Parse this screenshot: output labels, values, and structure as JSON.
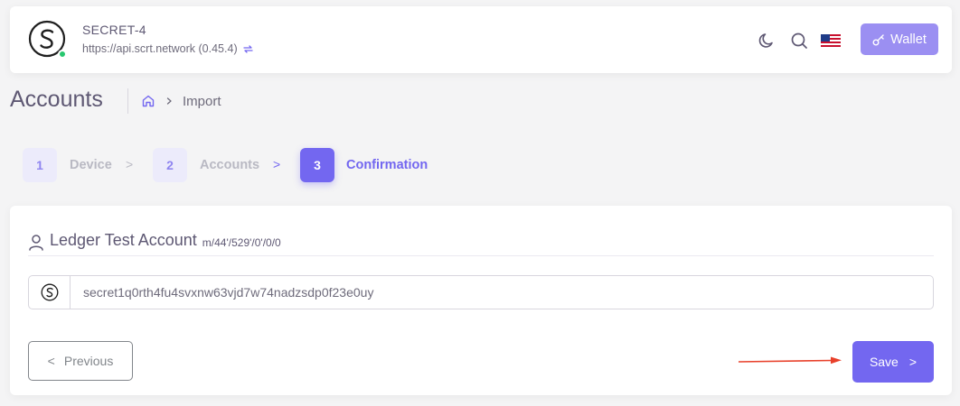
{
  "navbar": {
    "chain_name": "SECRET-4",
    "endpoint": "https://api.scrt.network (0.45.4)",
    "wallet_label": "Wallet",
    "icons": [
      "secret-logo-icon",
      "refresh-icon",
      "moon-icon",
      "search-icon",
      "us-flag-icon",
      "key-icon"
    ]
  },
  "header": {
    "title": "Accounts",
    "breadcrumb": {
      "current": "Import"
    }
  },
  "stepper": {
    "steps": [
      {
        "number": "1",
        "label": "Device",
        "active": false
      },
      {
        "number": "2",
        "label": "Accounts",
        "active": false
      },
      {
        "number": "3",
        "label": "Confirmation",
        "active": true
      }
    ],
    "separator": ">"
  },
  "account": {
    "name": "Ledger Test Account",
    "path": "m/44'/529'/0'/0/0",
    "address": "secret1q0rth4fu4svxnw63vjd7w74nadzsdp0f23e0uy"
  },
  "actions": {
    "previous_label": "Previous",
    "previous_icon": "<",
    "save_label": "Save",
    "save_icon": ">"
  },
  "colors": {
    "primary": "#7367f0",
    "primary_light": "#9b8ff2",
    "online": "#28c76f",
    "annotation_arrow": "#e8402a"
  }
}
